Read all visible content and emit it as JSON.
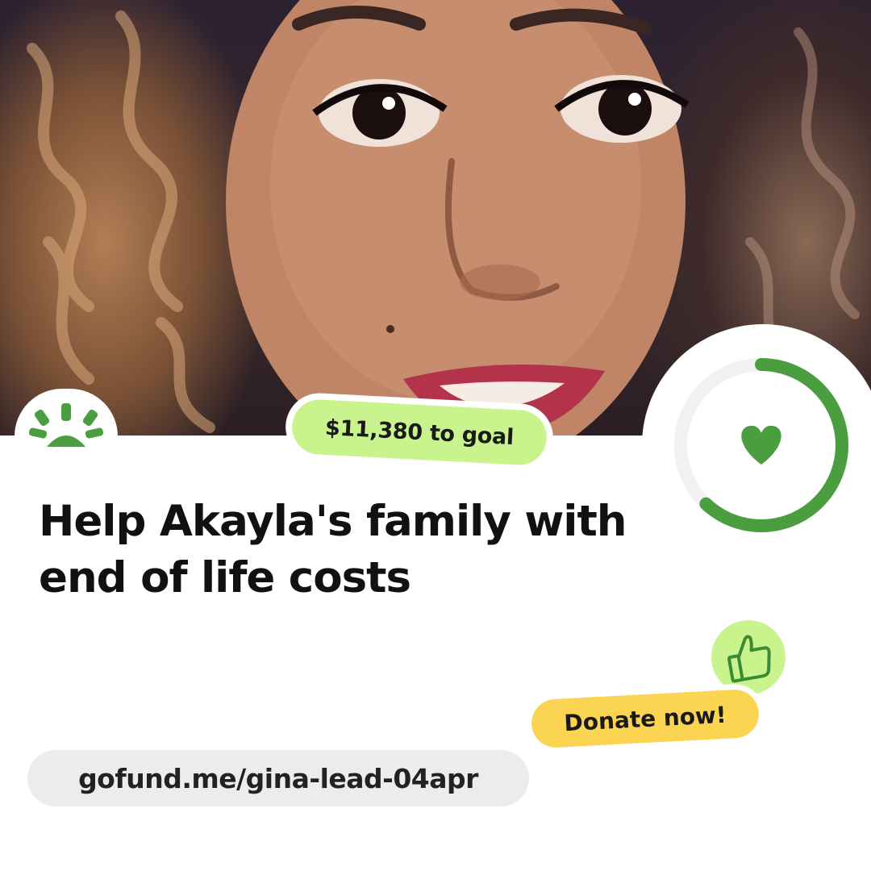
{
  "campaign": {
    "title": "Help Akayla's family with end of life costs",
    "goal_badge": "$11,380 to goal",
    "donate_label": "Donate now!",
    "url": "gofund.me/gina-lead-04apr",
    "progress_fraction": 0.62
  },
  "icons": {
    "logo": "gofundme-sun-logo-icon",
    "heart": "heart-icon",
    "thumb": "thumbs-up-icon"
  },
  "colors": {
    "brand_green": "#4a9e3f",
    "light_green": "#c9f48d",
    "yellow": "#fbd451",
    "track_gray": "#f1f1f1",
    "text": "#111111",
    "url_pill": "#ececec"
  }
}
